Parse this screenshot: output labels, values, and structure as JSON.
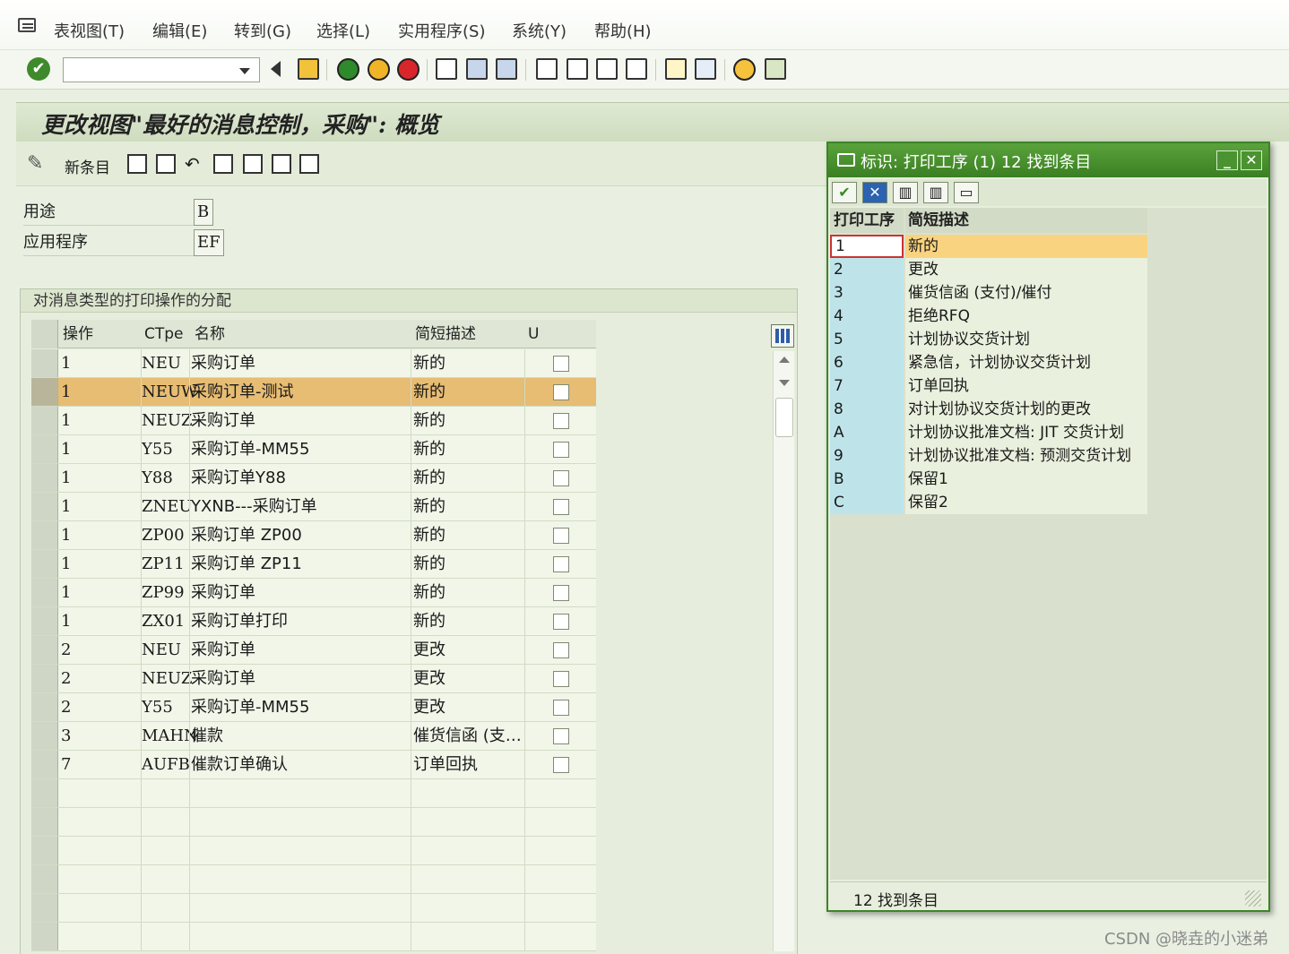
{
  "menu": [
    "表视图(T)",
    "编辑(E)",
    "转到(G)",
    "选择(L)",
    "实用程序(S)",
    "系统(Y)",
    "帮助(H)"
  ],
  "toolbar": {
    "command_value": ""
  },
  "page": {
    "title": "更改视图\"最好的消息控制，采购\": 概览",
    "new_entries": "新条目"
  },
  "header": {
    "fields": [
      {
        "label": "用途",
        "value": "B"
      },
      {
        "label": "应用程序",
        "value": "EF"
      }
    ]
  },
  "group": {
    "title": "对消息类型的打印操作的分配"
  },
  "table": {
    "columns": [
      "操作",
      "CTpe",
      "名称",
      "简短描述",
      "U"
    ],
    "rows": [
      {
        "op": "1",
        "ctpe": "NEU",
        "name": "采购订单",
        "desc": "新的",
        "selected": false
      },
      {
        "op": "1",
        "ctpe": "NEUW",
        "name": "采购订单-测试",
        "desc": "新的",
        "selected": true
      },
      {
        "op": "1",
        "ctpe": "NEUZ",
        "name": "采购订单",
        "desc": "新的",
        "selected": false
      },
      {
        "op": "1",
        "ctpe": "Y55",
        "name": "采购订单-MM55",
        "desc": "新的",
        "selected": false
      },
      {
        "op": "1",
        "ctpe": "Y88",
        "name": "采购订单Y88",
        "desc": "新的",
        "selected": false
      },
      {
        "op": "1",
        "ctpe": "ZNEU",
        "name": "YXNB---采购订单",
        "desc": "新的",
        "selected": false
      },
      {
        "op": "1",
        "ctpe": "ZP00",
        "name": "采购订单  ZP00",
        "desc": "新的",
        "selected": false
      },
      {
        "op": "1",
        "ctpe": "ZP11",
        "name": "采购订单  ZP11",
        "desc": "新的",
        "selected": false
      },
      {
        "op": "1",
        "ctpe": "ZP99",
        "name": "采购订单",
        "desc": "新的",
        "selected": false
      },
      {
        "op": "1",
        "ctpe": "ZX01",
        "name": "采购订单打印",
        "desc": "新的",
        "selected": false
      },
      {
        "op": "2",
        "ctpe": "NEU",
        "name": "采购订单",
        "desc": "更改",
        "selected": false
      },
      {
        "op": "2",
        "ctpe": "NEUZ",
        "name": "采购订单",
        "desc": "更改",
        "selected": false
      },
      {
        "op": "2",
        "ctpe": "Y55",
        "name": "采购订单-MM55",
        "desc": "更改",
        "selected": false
      },
      {
        "op": "3",
        "ctpe": "MAHN",
        "name": "催款",
        "desc": "催货信函 (支…",
        "selected": false
      },
      {
        "op": "7",
        "ctpe": "AUFB",
        "name": "催款订单确认",
        "desc": "订单回执",
        "selected": false
      }
    ],
    "empty_rows": 6
  },
  "popup": {
    "title": "标识: 打印工序 (1)   12 找到条目",
    "columns": [
      "打印工序",
      "简短描述"
    ],
    "rows": [
      {
        "code": "1",
        "desc": "新的",
        "selected": true
      },
      {
        "code": "2",
        "desc": "更改",
        "selected": false
      },
      {
        "code": "3",
        "desc": "催货信函 (支付)/催付",
        "selected": false
      },
      {
        "code": "4",
        "desc": "拒绝RFQ",
        "selected": false
      },
      {
        "code": "5",
        "desc": "计划协议交货计划",
        "selected": false
      },
      {
        "code": "6",
        "desc": "紧急信，计划协议交货计划",
        "selected": false
      },
      {
        "code": "7",
        "desc": "订单回执",
        "selected": false
      },
      {
        "code": "8",
        "desc": "对计划协议交货计划的更改",
        "selected": false
      },
      {
        "code": "A",
        "desc": "计划协议批准文档: JIT 交货计划",
        "selected": false
      },
      {
        "code": "9",
        "desc": "计划协议批准文档: 预测交货计划",
        "selected": false
      },
      {
        "code": "B",
        "desc": "保留1",
        "selected": false
      },
      {
        "code": "C",
        "desc": "保留2",
        "selected": false
      }
    ],
    "status": "12 找到条目"
  },
  "watermark": "CSDN @晓垚的小迷弟",
  "colors": {
    "accent": "#3e8428",
    "selected_row": "#e7bc73",
    "popup_selected": "#f9d37f"
  }
}
